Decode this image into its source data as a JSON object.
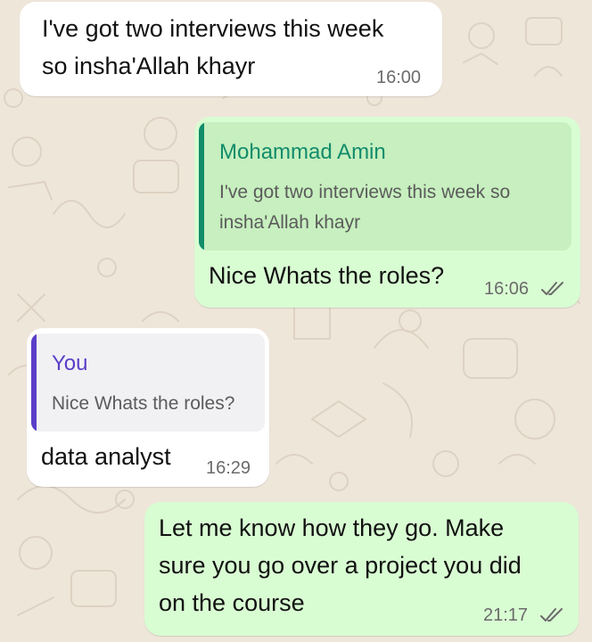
{
  "colors": {
    "wallpaper": "#efe6da",
    "incoming_bubble": "#ffffff",
    "outgoing_bubble": "#d9fdd3",
    "quote_in_outgoing": "#c7efbf",
    "quote_in_incoming": "#f1f1f4",
    "sender_green": "#128c6b",
    "sender_purple": "#5b3ec8",
    "read_ticks": "#6b6b6b"
  },
  "messages": [
    {
      "id": "m1",
      "direction": "incoming",
      "lines": [
        "I've got two interviews this week",
        "so insha'Allah khayr"
      ],
      "time": "16:00"
    },
    {
      "id": "m2",
      "direction": "outgoing",
      "quote": {
        "sender": "Mohammad Amin",
        "lines": [
          "I've got two interviews this week so",
          "insha'Allah khayr"
        ]
      },
      "text": "Nice Whats the roles?",
      "time": "16:06",
      "status": "double-check-icon"
    },
    {
      "id": "m3",
      "direction": "incoming",
      "quote": {
        "sender": "You",
        "lines": [
          "Nice Whats the roles?"
        ]
      },
      "text": "data analyst",
      "time": "16:29"
    },
    {
      "id": "m4",
      "direction": "outgoing",
      "lines": [
        "Let me know how they go. Make",
        "sure you go over a project you did",
        "on the course"
      ],
      "time": "21:17",
      "status": "double-check-icon"
    }
  ]
}
